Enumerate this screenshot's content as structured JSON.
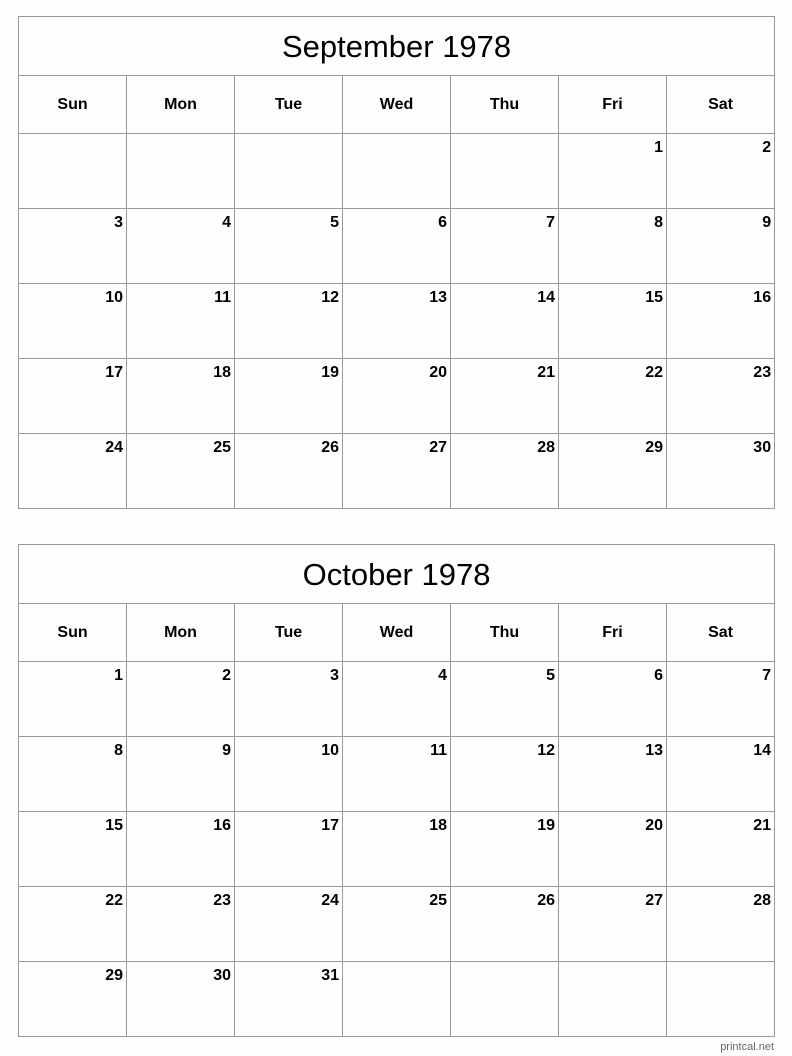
{
  "weekdays": [
    "Sun",
    "Mon",
    "Tue",
    "Wed",
    "Thu",
    "Fri",
    "Sat"
  ],
  "calendars": [
    {
      "title": "September 1978",
      "weeks": [
        [
          "",
          "",
          "",
          "",
          "",
          "1",
          "2"
        ],
        [
          "3",
          "4",
          "5",
          "6",
          "7",
          "8",
          "9"
        ],
        [
          "10",
          "11",
          "12",
          "13",
          "14",
          "15",
          "16"
        ],
        [
          "17",
          "18",
          "19",
          "20",
          "21",
          "22",
          "23"
        ],
        [
          "24",
          "25",
          "26",
          "27",
          "28",
          "29",
          "30"
        ]
      ]
    },
    {
      "title": "October 1978",
      "weeks": [
        [
          "1",
          "2",
          "3",
          "4",
          "5",
          "6",
          "7"
        ],
        [
          "8",
          "9",
          "10",
          "11",
          "12",
          "13",
          "14"
        ],
        [
          "15",
          "16",
          "17",
          "18",
          "19",
          "20",
          "21"
        ],
        [
          "22",
          "23",
          "24",
          "25",
          "26",
          "27",
          "28"
        ],
        [
          "29",
          "30",
          "31",
          "",
          "",
          "",
          ""
        ]
      ]
    }
  ],
  "watermark": "printcal.net"
}
